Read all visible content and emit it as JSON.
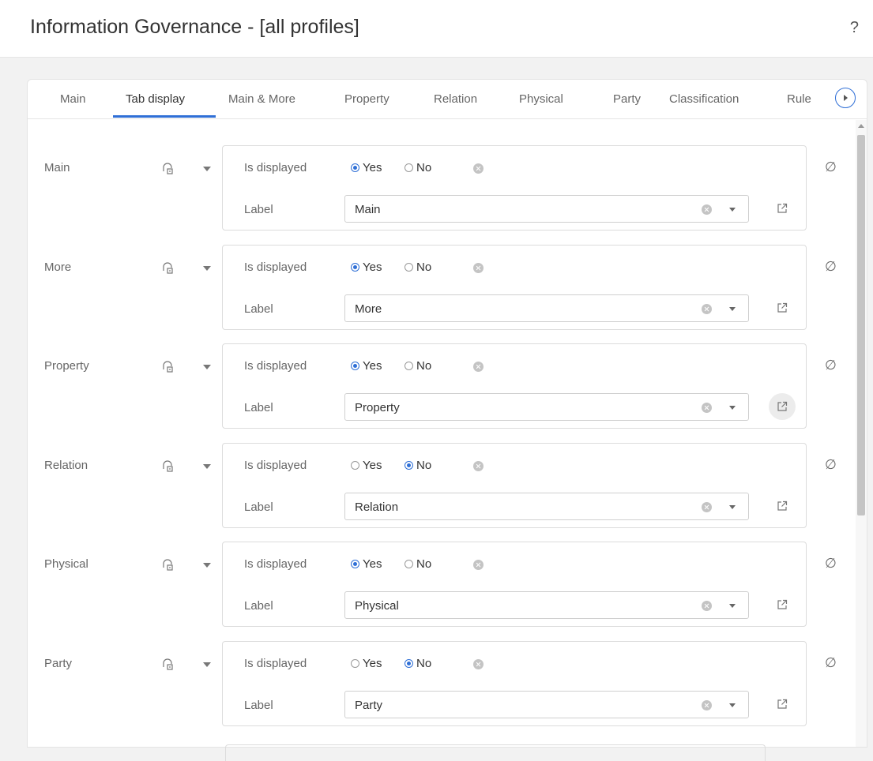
{
  "header": {
    "title": "Information Governance - [all profiles]",
    "help": "?"
  },
  "tabs": [
    "Main",
    "Tab display",
    "Main & More",
    "Property",
    "Relation",
    "Physical",
    "Party",
    "Classification",
    "Rule"
  ],
  "active_tab": "Tab display",
  "field_labels": {
    "is_displayed": "Is displayed",
    "label": "Label"
  },
  "radio_labels": {
    "yes": "Yes",
    "no": "No"
  },
  "null_icon": "∅",
  "rows": [
    {
      "name": "Main",
      "is_displayed": "Yes",
      "label_value": "Main"
    },
    {
      "name": "More",
      "is_displayed": "Yes",
      "label_value": "More"
    },
    {
      "name": "Property",
      "is_displayed": "Yes",
      "label_value": "Property"
    },
    {
      "name": "Relation",
      "is_displayed": "No",
      "label_value": "Relation"
    },
    {
      "name": "Physical",
      "is_displayed": "Yes",
      "label_value": "Physical"
    },
    {
      "name": "Party",
      "is_displayed": "No",
      "label_value": "Party"
    }
  ],
  "colors": {
    "accent": "#2f6fd6",
    "muted": "#c4c4c4"
  }
}
